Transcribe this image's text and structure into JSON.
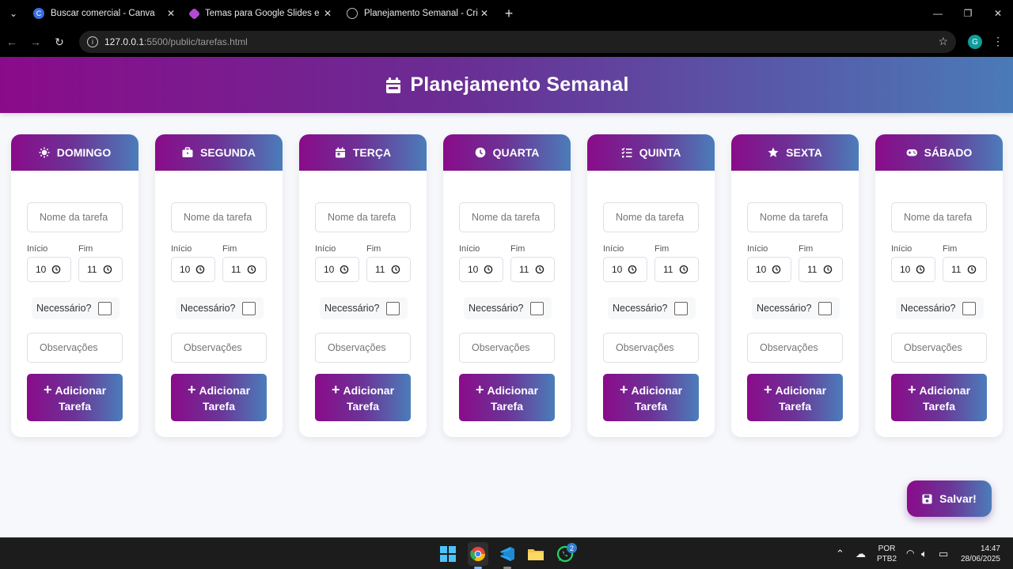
{
  "browser": {
    "tabs": [
      {
        "title": "Buscar comercial - Canva",
        "icon": "canva-icon",
        "color": "#3b6fe0"
      },
      {
        "title": "Temas para Google Slides e mo",
        "icon": "slides-theme-icon",
        "color": "#b04ad0"
      },
      {
        "title": "Planejamento Semanal - Criar T",
        "icon": "globe-icon",
        "color": "#bbbbbb"
      }
    ],
    "url_host": "127.0.0.1",
    "url_path": ":5500/public/tarefas.html",
    "profile_initial": "G"
  },
  "page": {
    "title": "Planejamento Semanal",
    "days": [
      {
        "name": "DOMINGO",
        "icon": "sun-icon"
      },
      {
        "name": "SEGUNDA",
        "icon": "briefcase-icon"
      },
      {
        "name": "TERÇA",
        "icon": "calendar-day-icon"
      },
      {
        "name": "QUARTA",
        "icon": "clock-icon"
      },
      {
        "name": "QUINTA",
        "icon": "list-check-icon"
      },
      {
        "name": "SEXTA",
        "icon": "star-icon"
      },
      {
        "name": "SÁBADO",
        "icon": "gamepad-icon"
      }
    ],
    "form": {
      "task_placeholder": "Nome da tarefa",
      "start_label": "Início",
      "end_label": "Fim",
      "start_value": "10",
      "end_value": "11",
      "required_label": "Necessário?",
      "notes_placeholder": "Observações",
      "add_button": "Adicionar Tarefa"
    },
    "save_button": "Salvar!"
  },
  "taskbar": {
    "apps": [
      "windows-start-icon",
      "chrome-icon",
      "vscode-icon",
      "file-explorer-icon",
      "whatsapp-icon"
    ],
    "whatsapp_badge": "2",
    "lang_line1": "POR",
    "lang_line2": "PTB2",
    "time": "14:47",
    "date": "28/06/2025"
  },
  "colors": {
    "gradient_start": "#8a0b8a",
    "gradient_end": "#4b7dba"
  }
}
